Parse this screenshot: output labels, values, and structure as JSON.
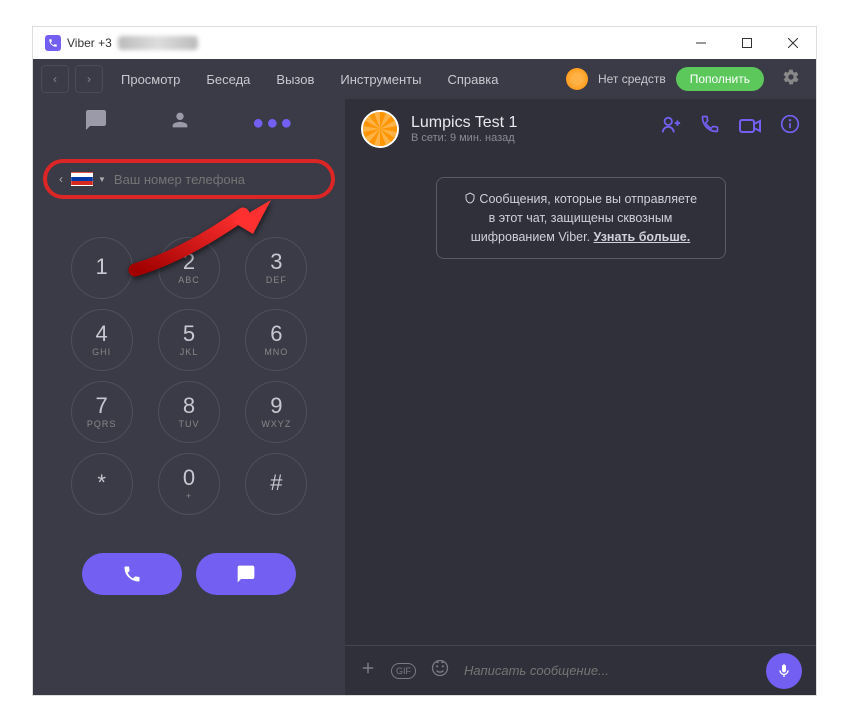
{
  "titlebar": {
    "app_prefix": "Viber +3"
  },
  "menubar": {
    "items": [
      "Просмотр",
      "Беседа",
      "Вызов",
      "Инструменты",
      "Справка"
    ],
    "no_funds": "Нет средств",
    "topup": "Пополнить"
  },
  "phone": {
    "placeholder": "Ваш номер телефона"
  },
  "keypad": {
    "keys": [
      {
        "num": "1",
        "letters": ""
      },
      {
        "num": "2",
        "letters": "ABC"
      },
      {
        "num": "3",
        "letters": "DEF"
      },
      {
        "num": "4",
        "letters": "GHI"
      },
      {
        "num": "5",
        "letters": "JKL"
      },
      {
        "num": "6",
        "letters": "MNO"
      },
      {
        "num": "7",
        "letters": "PQRS"
      },
      {
        "num": "8",
        "letters": "TUV"
      },
      {
        "num": "9",
        "letters": "WXYZ"
      },
      {
        "num": "*",
        "letters": ""
      },
      {
        "num": "0",
        "letters": "+"
      },
      {
        "num": "#",
        "letters": ""
      }
    ]
  },
  "chat": {
    "name": "Lumpics Test 1",
    "status": "В сети: 9 мин. назад",
    "encryption_l1": "Сообщения, которые вы отправляете",
    "encryption_l2": "в этот чат, защищены сквозным",
    "encryption_l3": "шифрованием Viber.",
    "learn_more": "Узнать больше.",
    "input_placeholder": "Написать сообщение...",
    "gif_label": "GIF"
  }
}
